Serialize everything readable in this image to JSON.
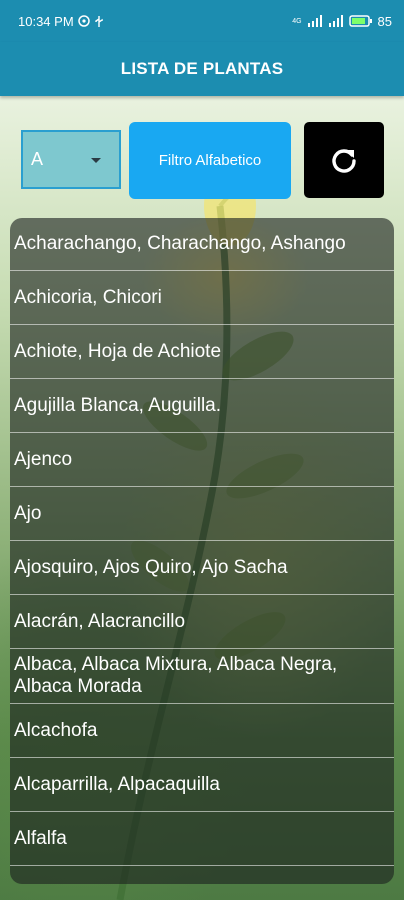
{
  "status_bar": {
    "time": "10:34 PM",
    "battery": "85",
    "network_label": "4G"
  },
  "app_bar": {
    "title": "LISTA DE PLANTAS"
  },
  "controls": {
    "letter_select_value": "A",
    "filter_button_label": "Filtro Alfabetico"
  },
  "plants": [
    "Acharachango, Charachango, Ashango",
    "Achicoria, Chicori",
    "Achiote, Hoja de Achiote",
    "Agujilla Blanca, Auguilla.",
    "Ajenco",
    "Ajo",
    "Ajosquiro, Ajos Quiro, Ajo Sacha",
    "Alacrán, Alacrancillo",
    "Albaca, Albaca Mixtura, Albaca Negra, Albaca Morada",
    "Alcachofa",
    "Alcaparrilla, Alpacaquilla",
    "Alfalfa"
  ],
  "colors": {
    "app_bar": "#1c8db0",
    "filter_button": "#19a8f2",
    "refresh_button": "#000000"
  }
}
